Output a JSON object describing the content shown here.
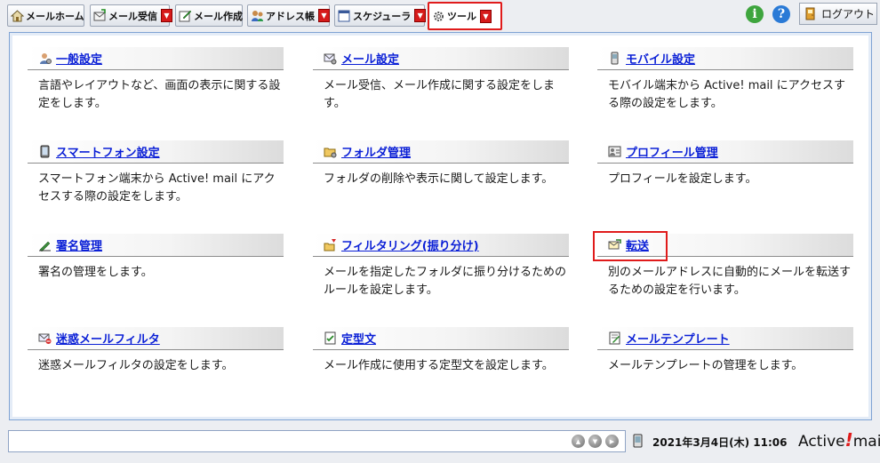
{
  "toolbar": {
    "mail_home": "メールホーム",
    "mail_receive": "メール受信",
    "mail_compose": "メール作成",
    "address_book": "アドレス帳",
    "scheduler": "スケジューラ",
    "tools": "ツール",
    "logout": "ログアウト"
  },
  "items": [
    {
      "title": "一般設定",
      "icon": "person-gear-icon",
      "desc": "言語やレイアウトなど、画面の表示に関する設定をします。"
    },
    {
      "title": "メール設定",
      "icon": "mail-gear-icon",
      "desc": "メール受信、メール作成に関する設定をします。"
    },
    {
      "title": "モバイル設定",
      "icon": "mobile-phone-icon",
      "desc": "モバイル端末から Active! mail にアクセスする際の設定をします。"
    },
    {
      "title": "スマートフォン設定",
      "icon": "smartphone-icon",
      "desc": "スマートフォン端末から Active! mail にアクセスする際の設定をします。"
    },
    {
      "title": "フォルダ管理",
      "icon": "folder-gear-icon",
      "desc": "フォルダの削除や表示に関して設定します。"
    },
    {
      "title": "プロフィール管理",
      "icon": "profile-card-icon",
      "desc": "プロフィールを設定します。"
    },
    {
      "title": "署名管理",
      "icon": "pen-icon",
      "desc": "署名の管理をします。"
    },
    {
      "title": "フィルタリング(振り分け)",
      "icon": "filter-sort-icon",
      "desc": "メールを指定したフォルダに振り分けるためのルールを設定します。"
    },
    {
      "title": "転送",
      "icon": "forward-mail-icon",
      "desc": "別のメールアドレスに自動的にメールを転送するための設定を行います。"
    },
    {
      "title": "迷惑メールフィルタ",
      "icon": "spam-filter-icon",
      "desc": "迷惑メールフィルタの設定をします。"
    },
    {
      "title": "定型文",
      "icon": "template-text-icon",
      "desc": "メール作成に使用する定型文を設定します。"
    },
    {
      "title": "メールテンプレート",
      "icon": "mail-template-icon",
      "desc": "メールテンプレートの管理をします。"
    }
  ],
  "status": {
    "datetime": "2021年3月4日(木) 11:06",
    "brand_prefix": "Active",
    "brand_bang": "!",
    "brand_suffix": "mail"
  },
  "colors": {
    "accent_red": "#e01b1b",
    "link_blue": "#0a1fd6",
    "panel_border": "#7fa3d3"
  }
}
